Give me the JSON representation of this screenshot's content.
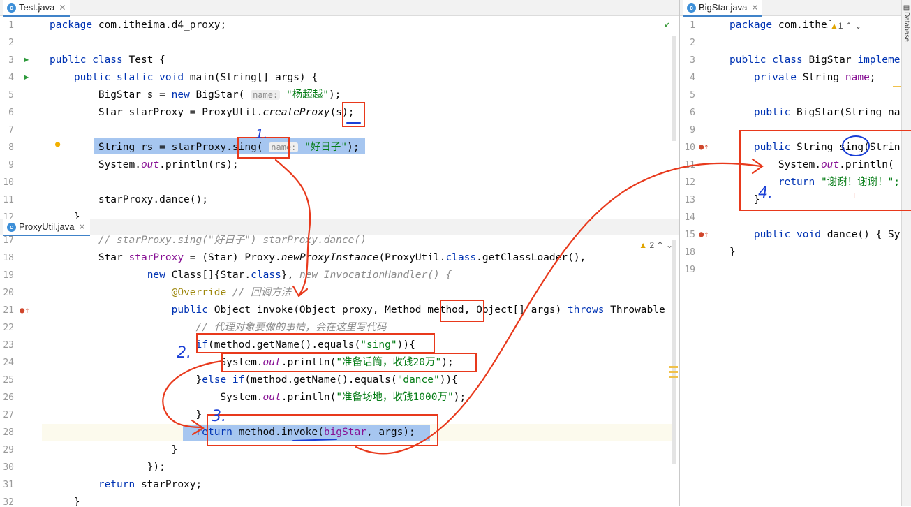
{
  "tabs": {
    "test": "Test.java",
    "proxyutil": "ProxyUtil.java",
    "bigstar": "BigStar.java",
    "sidebar": "Database"
  },
  "inspections": {
    "proxyutil": "2",
    "bigstar": "1"
  },
  "test_lines": [
    {
      "n": "1",
      "segs": [
        {
          "t": "package ",
          "c": "kw"
        },
        {
          "t": "com.itheima.d4_proxy;"
        }
      ]
    },
    {
      "n": "2",
      "segs": []
    },
    {
      "n": "3",
      "segs": [
        {
          "t": "public class ",
          "c": "kw"
        },
        {
          "t": "Test {"
        }
      ]
    },
    {
      "n": "4",
      "segs": [
        {
          "t": "    public static void ",
          "c": "kw"
        },
        {
          "t": "main(String[] args) {"
        }
      ]
    },
    {
      "n": "5",
      "segs": [
        {
          "t": "        BigStar s = "
        },
        {
          "t": "new ",
          "c": "kw"
        },
        {
          "t": "BigStar( "
        },
        {
          "t": "name:",
          "c": "hint"
        },
        {
          "t": " "
        },
        {
          "t": "\"杨超越\"",
          "c": "str"
        },
        {
          "t": ");"
        }
      ]
    },
    {
      "n": "6",
      "segs": [
        {
          "t": "        Star starProxy = ProxyUtil."
        },
        {
          "t": "createProxy",
          "c": "it"
        },
        {
          "t": "(s);"
        }
      ]
    },
    {
      "n": "7",
      "segs": []
    },
    {
      "n": "8",
      "segs": [
        {
          "t": "        String rs = starProxy.sing( "
        },
        {
          "t": "name:",
          "c": "hint"
        },
        {
          "t": " "
        },
        {
          "t": "\"好日子\"",
          "c": "str"
        },
        {
          "t": ");"
        }
      ]
    },
    {
      "n": "9",
      "segs": [
        {
          "t": "        System."
        },
        {
          "t": "out",
          "c": "fld it"
        },
        {
          "t": ".println(rs);"
        }
      ]
    },
    {
      "n": "10",
      "segs": []
    },
    {
      "n": "11",
      "segs": [
        {
          "t": "        starProxy.dance();"
        }
      ]
    },
    {
      "n": "12",
      "segs": [
        {
          "t": "    }"
        }
      ]
    }
  ],
  "proxy_lines": [
    {
      "n": "17",
      "segs": [
        {
          "t": "        // starProxy.sing(\"好日子\") starProxy.dance()",
          "c": "cm"
        }
      ]
    },
    {
      "n": "18",
      "segs": [
        {
          "t": "        Star "
        },
        {
          "t": "starProxy",
          "c": "fld"
        },
        {
          "t": " = (Star) Proxy."
        },
        {
          "t": "newProxyInstance",
          "c": "it"
        },
        {
          "t": "(ProxyUtil."
        },
        {
          "t": "class",
          "c": "kw"
        },
        {
          "t": ".getClassLoader(),"
        }
      ]
    },
    {
      "n": "19",
      "segs": [
        {
          "t": "                "
        },
        {
          "t": "new ",
          "c": "kw"
        },
        {
          "t": "Class[]{Star."
        },
        {
          "t": "class",
          "c": "kw"
        },
        {
          "t": "}, "
        },
        {
          "t": "new InvocationHandler() {",
          "c": "cm"
        }
      ]
    },
    {
      "n": "20",
      "segs": [
        {
          "t": "                    "
        },
        {
          "t": "@Override",
          "c": "ann"
        },
        {
          "t": " // 回调方法",
          "c": "cm"
        }
      ]
    },
    {
      "n": "21",
      "segs": [
        {
          "t": "                    "
        },
        {
          "t": "public ",
          "c": "kw"
        },
        {
          "t": "Object invoke(Object proxy, Method method, Object[] args) "
        },
        {
          "t": "throws ",
          "c": "kw"
        },
        {
          "t": "Throwable {"
        }
      ]
    },
    {
      "n": "22",
      "segs": [
        {
          "t": "                        // 代理对象要做的事情，会在这里写代码",
          "c": "cm"
        }
      ]
    },
    {
      "n": "23",
      "segs": [
        {
          "t": "                        "
        },
        {
          "t": "if",
          "c": "kw"
        },
        {
          "t": "(method.getName().equals("
        },
        {
          "t": "\"sing\"",
          "c": "str"
        },
        {
          "t": ")){"
        }
      ]
    },
    {
      "n": "24",
      "segs": [
        {
          "t": "                            System."
        },
        {
          "t": "out",
          "c": "fld it"
        },
        {
          "t": ".println("
        },
        {
          "t": "\"准备话筒，收钱20万\"",
          "c": "str"
        },
        {
          "t": ");"
        }
      ]
    },
    {
      "n": "25",
      "segs": [
        {
          "t": "                        }"
        },
        {
          "t": "else if",
          "c": "kw"
        },
        {
          "t": "(method.getName().equals("
        },
        {
          "t": "\"dance\"",
          "c": "str"
        },
        {
          "t": ")){"
        }
      ]
    },
    {
      "n": "26",
      "segs": [
        {
          "t": "                            System."
        },
        {
          "t": "out",
          "c": "fld it"
        },
        {
          "t": ".println("
        },
        {
          "t": "\"准备场地，收钱1000万\"",
          "c": "str"
        },
        {
          "t": ");"
        }
      ]
    },
    {
      "n": "27",
      "segs": [
        {
          "t": "                        }"
        }
      ]
    },
    {
      "n": "28",
      "segs": [
        {
          "t": "                        "
        },
        {
          "t": "return ",
          "c": "kw"
        },
        {
          "t": "method.invoke("
        },
        {
          "t": "bigStar",
          "c": "fld"
        },
        {
          "t": ", args);"
        }
      ]
    },
    {
      "n": "29",
      "segs": [
        {
          "t": "                    }"
        }
      ]
    },
    {
      "n": "30",
      "segs": [
        {
          "t": "                });"
        }
      ]
    },
    {
      "n": "31",
      "segs": [
        {
          "t": "        "
        },
        {
          "t": "return ",
          "c": "kw"
        },
        {
          "t": "starProxy;"
        }
      ]
    },
    {
      "n": "32",
      "segs": [
        {
          "t": "    }"
        }
      ]
    }
  ],
  "bigstar_lines": [
    {
      "n": "1",
      "segs": [
        {
          "t": "package ",
          "c": "kw"
        },
        {
          "t": "com.itheima"
        }
      ]
    },
    {
      "n": "2",
      "segs": []
    },
    {
      "n": "3",
      "segs": [
        {
          "t": "public class ",
          "c": "kw"
        },
        {
          "t": "BigStar "
        },
        {
          "t": "impleme",
          "c": "kw"
        }
      ]
    },
    {
      "n": "4",
      "segs": [
        {
          "t": "    private ",
          "c": "kw"
        },
        {
          "t": "String "
        },
        {
          "t": "name",
          "c": "fld"
        },
        {
          "t": ";"
        }
      ]
    },
    {
      "n": "5",
      "segs": []
    },
    {
      "n": "6",
      "segs": [
        {
          "t": "    public ",
          "c": "kw"
        },
        {
          "t": "BigStar(String na"
        }
      ]
    },
    {
      "n": "9",
      "segs": []
    },
    {
      "n": "10",
      "segs": [
        {
          "t": "    public ",
          "c": "kw"
        },
        {
          "t": "String sing(Strin"
        }
      ]
    },
    {
      "n": "11",
      "segs": [
        {
          "t": "        System."
        },
        {
          "t": "out",
          "c": "fld it"
        },
        {
          "t": ".println("
        }
      ]
    },
    {
      "n": "12",
      "segs": [
        {
          "t": "        "
        },
        {
          "t": "return ",
          "c": "kw"
        },
        {
          "t": "\"谢谢！谢谢！\";",
          "c": "str"
        }
      ]
    },
    {
      "n": "13",
      "segs": [
        {
          "t": "    }"
        }
      ]
    },
    {
      "n": "14",
      "segs": []
    },
    {
      "n": "15",
      "segs": [
        {
          "t": "    public ",
          "c": "kw"
        },
        {
          "t": "void ",
          "c": "kw"
        },
        {
          "t": "dance() { Sy"
        }
      ]
    },
    {
      "n": "18",
      "segs": [
        {
          "t": "}"
        }
      ]
    },
    {
      "n": "19",
      "segs": []
    }
  ],
  "annotations": [
    "1.",
    "2.",
    "3.",
    "4."
  ],
  "colors": {
    "annotation_red": "#e8391c",
    "annotation_blue": "#1a3fd6",
    "selection": "#a6c6f0",
    "keyword": "#0033b3",
    "string": "#067d17"
  }
}
